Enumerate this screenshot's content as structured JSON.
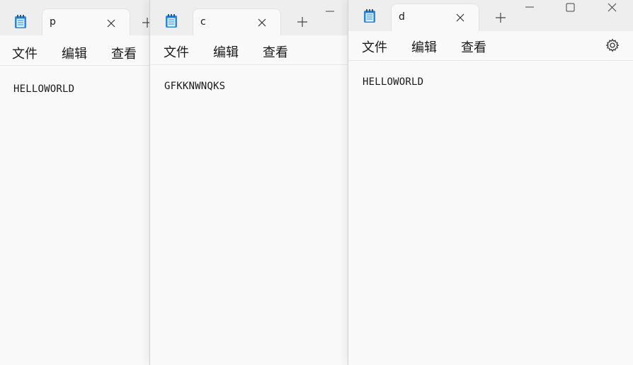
{
  "windows": [
    {
      "id": "win1",
      "tab_title": "p",
      "menu": [
        "文件",
        "编辑",
        "查看"
      ],
      "content": "HELLOWORLD",
      "icon": "notepad-icon"
    },
    {
      "id": "win2",
      "tab_title": "c",
      "menu": [
        "文件",
        "编辑",
        "查看"
      ],
      "content": "GFKKNWNQKS",
      "icon": "notepad-icon"
    },
    {
      "id": "win3",
      "tab_title": "d",
      "menu": [
        "文件",
        "编辑",
        "查看"
      ],
      "content": "HELLOWORLD",
      "icon": "notepad-icon"
    }
  ],
  "icons": {
    "close_tab": "close-icon",
    "new_tab": "plus-icon",
    "minimize": "minimize-icon",
    "maximize": "maximize-icon",
    "close_window": "close-window-icon",
    "settings": "gear-icon"
  },
  "colors": {
    "notepad_icon": "#2b88d8",
    "text": "#1a1a1a",
    "background": "#f9f9f9"
  }
}
